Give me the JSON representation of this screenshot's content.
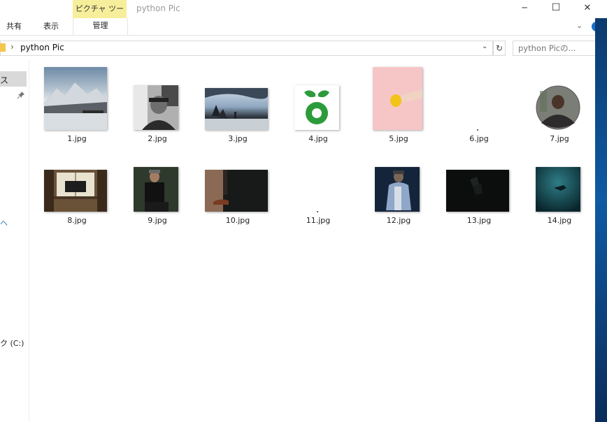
{
  "window": {
    "title": "python Pic",
    "contextual_tab": "ピクチャ ツール",
    "minimize": "─",
    "maximize": "☐",
    "close": "✕"
  },
  "ribbon": {
    "tabs": [
      "共有",
      "表示"
    ],
    "manage_tab": "管理",
    "chevron": "⌄",
    "help": "?"
  },
  "address": {
    "separator": "›",
    "crumb": "python Pic",
    "dropdown": "⌄",
    "refresh": "↻"
  },
  "search": {
    "placeholder": "python Picの..."
  },
  "nav": {
    "quick_access_label": "ス",
    "pin_icon": "📌",
    "mark": "ヘ",
    "drive_label": "ク (C:)"
  },
  "files": [
    {
      "name": "1.jpg",
      "icon": "mountain-lake-thumbnail"
    },
    {
      "name": "2.jpg",
      "icon": "man-hat-bw-thumbnail"
    },
    {
      "name": "3.jpg",
      "icon": "coast-rocks-thumbnail"
    },
    {
      "name": "4.jpg",
      "icon": "green-apple-logo-thumbnail"
    },
    {
      "name": "5.jpg",
      "icon": "hand-lemon-pink-thumbnail"
    },
    {
      "name": "6.jpg",
      "icon": "blank-thumbnail"
    },
    {
      "name": "7.jpg",
      "icon": "round-portrait-thumbnail"
    },
    {
      "name": "8.jpg",
      "icon": "window-desk-thumbnail"
    },
    {
      "name": "9.jpg",
      "icon": "man-sitting-thumbnail"
    },
    {
      "name": "10.jpg",
      "icon": "shoes-wall-thumbnail"
    },
    {
      "name": "11.jpg",
      "icon": "blank-thumbnail"
    },
    {
      "name": "12.jpg",
      "icon": "man-hoodie-thumbnail"
    },
    {
      "name": "13.jpg",
      "icon": "dark-stairs-thumbnail"
    },
    {
      "name": "14.jpg",
      "icon": "underwater-thumbnail"
    }
  ],
  "colors": {
    "contextual_tab_bg": "#f7ee9b",
    "help_blue": "#1a6fc9",
    "selection_gray": "#d9d9d9"
  }
}
